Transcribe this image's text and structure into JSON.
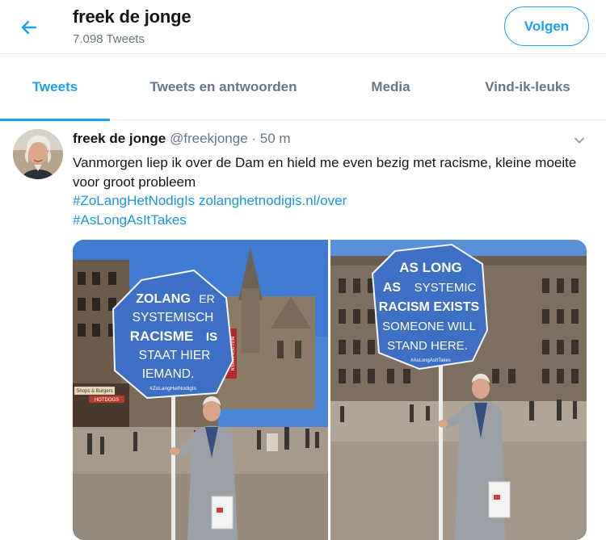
{
  "header": {
    "back_icon": "arrow-left-icon",
    "profile_name": "freek de jonge",
    "tweet_count": "7.098 Tweets",
    "follow_label": "Volgen"
  },
  "tabs": [
    {
      "label": "Tweets",
      "active": true
    },
    {
      "label": "Tweets en antwoorden",
      "active": false
    },
    {
      "label": "Media",
      "active": false
    },
    {
      "label": "Vind-ik-leuks",
      "active": false
    }
  ],
  "tweet": {
    "author_name": "freek de jonge",
    "author_handle": "@freekjonge",
    "separator": "·",
    "time": "50 m",
    "caret_icon": "chevron-down-icon",
    "text": "Vanmorgen liep ik over de Dam en hield me even bezig met racisme, kleine moeite voor groot probleem",
    "hashtag_1": "#ZoLangHetNodigIs",
    "link": "zolanghetnodigis.nl/over",
    "hashtag_2": "#AsLongAsItTakes"
  },
  "photos": {
    "left_sign": {
      "line_1a": "ZOLANG",
      "line_1b": "ER",
      "line_2": "SYSTEMISCH",
      "line_3a": "RACISME",
      "line_3b": "IS",
      "line_4": "STAAT HIER",
      "line_5": "IEMAND.",
      "hashtag": "#ZoLangHetNodigIs"
    },
    "right_sign": {
      "line_1": "AS LONG",
      "line_2a": "AS",
      "line_2b": "SYSTEMIC",
      "line_3": "RACISM EXISTS",
      "line_4": "SOMEONE WILL",
      "line_5": "STAND HERE.",
      "hashtag": "#AsLongAsItTakes"
    },
    "storefront_sign": "Shops & Burgers",
    "shop_name": "HOTDOGS",
    "banner_text": "BEELDEN MAKEN"
  },
  "colors": {
    "accent": "#1da1f2",
    "link": "#1b95e0",
    "text": "#14171a",
    "secondary": "#657786",
    "sign_blue": "#3d6fc4",
    "sky": "#4a86d6"
  }
}
